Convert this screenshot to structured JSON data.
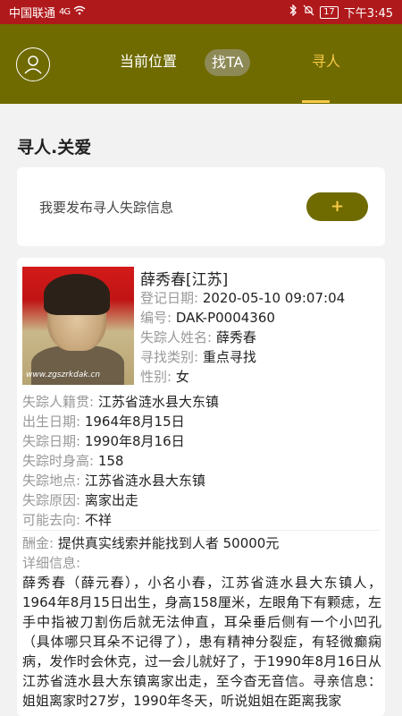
{
  "status_bar": {
    "carrier": "中国联通",
    "network": "4G",
    "battery": "17",
    "time": "下午3:45"
  },
  "nav": {
    "tab_location": "当前位置",
    "tab_find": "找TA",
    "tab_search": "寻人",
    "active_color": "#f7c948",
    "bar_color": "#6f6b00"
  },
  "section_title": "寻人.关爱",
  "publish": {
    "label": "我要发布寻人失踪信息",
    "button": "+"
  },
  "person": {
    "photo_watermark": "www.zgszrkdak.cn",
    "name": "薛秀春[江苏]",
    "reg_date_key": "登记日期:",
    "reg_date": "2020-05-10 09:07:04",
    "id_key": "编号:",
    "id": "DAK-P0004360",
    "missing_name_key": "失踪人姓名:",
    "missing_name": "薛秀春",
    "category_key": "寻找类别:",
    "category": "重点寻找",
    "gender_key": "性别:",
    "gender": "女",
    "native_key": "失踪人籍贯:",
    "native": "江苏省涟水县大东镇",
    "birth_key": "出生日期:",
    "birth": "1964年8月15日",
    "missing_date_key": "失踪日期:",
    "missing_date": "1990年8月16日",
    "height_key": "失踪时身高:",
    "height": "158",
    "place_key": "失踪地点:",
    "place": "江苏省涟水县大东镇",
    "reason_key": "失踪原因:",
    "reason": "离家出走",
    "destination_key": "可能去向:",
    "destination": "不祥",
    "reward_key": "酬金:",
    "reward": "提供真实线索并能找到人者 50000元",
    "detail_key": "详细信息:",
    "detail": "薛秀春（薛元春），小名小春，江苏省涟水县大东镇人，1964年8月15日出生，身高158厘米，左眼角下有颗痣，左手中指被刀割伤后就无法伸直，耳朵垂后侧有一个小凹孔（具体哪只耳朵不记得了），患有精神分裂症，有轻微癫痫病，发作时会休克，过一会儿就好了，于1990年8月16日从江苏省涟水县大东镇离家出走，至今杳无音信。寻亲信息：姐姐离家时27岁，1990年冬天，听说姐姐在距离我家"
  }
}
